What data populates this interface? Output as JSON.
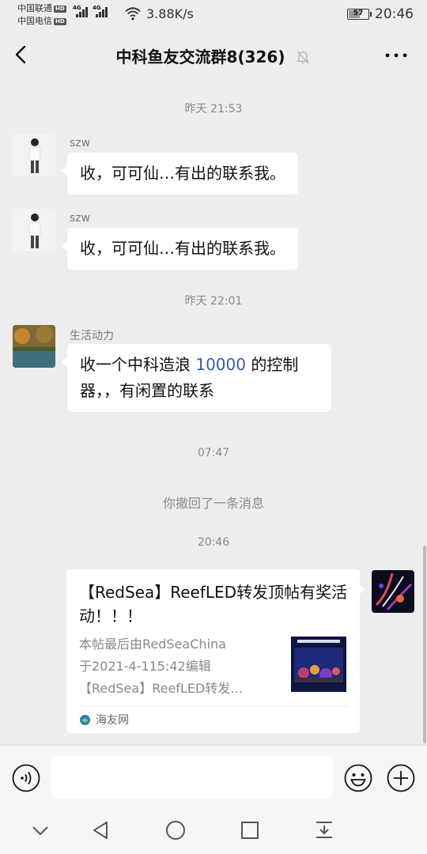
{
  "status_bar": {
    "carrier_1": "中国联通",
    "carrier_2": "中国电信",
    "hd_badge": "HD",
    "network_1": "4G",
    "network_2": "4G",
    "speed": "3.88K/s",
    "battery_level": 57,
    "battery_label": "57",
    "time": "20:46"
  },
  "header": {
    "title": "中科鱼友交流群8(326)",
    "back_icon": "chevron-left-icon",
    "mute_icon": "bell-off-icon",
    "more_icon": "more-dots-icon"
  },
  "messages": [
    {
      "type": "time",
      "text": "昨天 21:53"
    },
    {
      "type": "text",
      "sender": "szw",
      "text": "收，可可仙…有出的联系我。"
    },
    {
      "type": "text",
      "sender": "szw",
      "text": "收，可可仙…有出的联系我。"
    },
    {
      "type": "time",
      "text": "昨天 22:01"
    },
    {
      "type": "text",
      "sender": "生活动力",
      "text_a": "收一个中科造浪 ",
      "text_number": "10000",
      "text_b": " 的控制器，，有闲置的联系"
    },
    {
      "type": "time",
      "text": "07:47"
    },
    {
      "type": "system",
      "text": "你撤回了一条消息"
    },
    {
      "type": "time",
      "text": "20:46"
    },
    {
      "type": "link_card",
      "title": "【RedSea】ReefLED转发顶帖有奖活动！！！",
      "desc_line1": "本帖最后由RedSeaChina",
      "desc_line2": "于2021-4-115:42编辑",
      "desc_line3": "【RedSea】ReefLED转发…",
      "source": "海友网"
    }
  ],
  "input_bar": {
    "voice_icon": "voice-icon",
    "input_value": "",
    "emoji_icon": "emoji-icon",
    "plus_icon": "plus-circle-icon"
  },
  "nav_bar": {
    "icons": [
      "chevron-down-icon",
      "back-triangle-icon",
      "home-circle-icon",
      "recents-square-icon",
      "notification-pull-icon"
    ]
  },
  "colors": {
    "background": "#ededed",
    "bubble": "#ffffff",
    "number_link": "#3b5ba5",
    "muted_text": "#888888"
  }
}
